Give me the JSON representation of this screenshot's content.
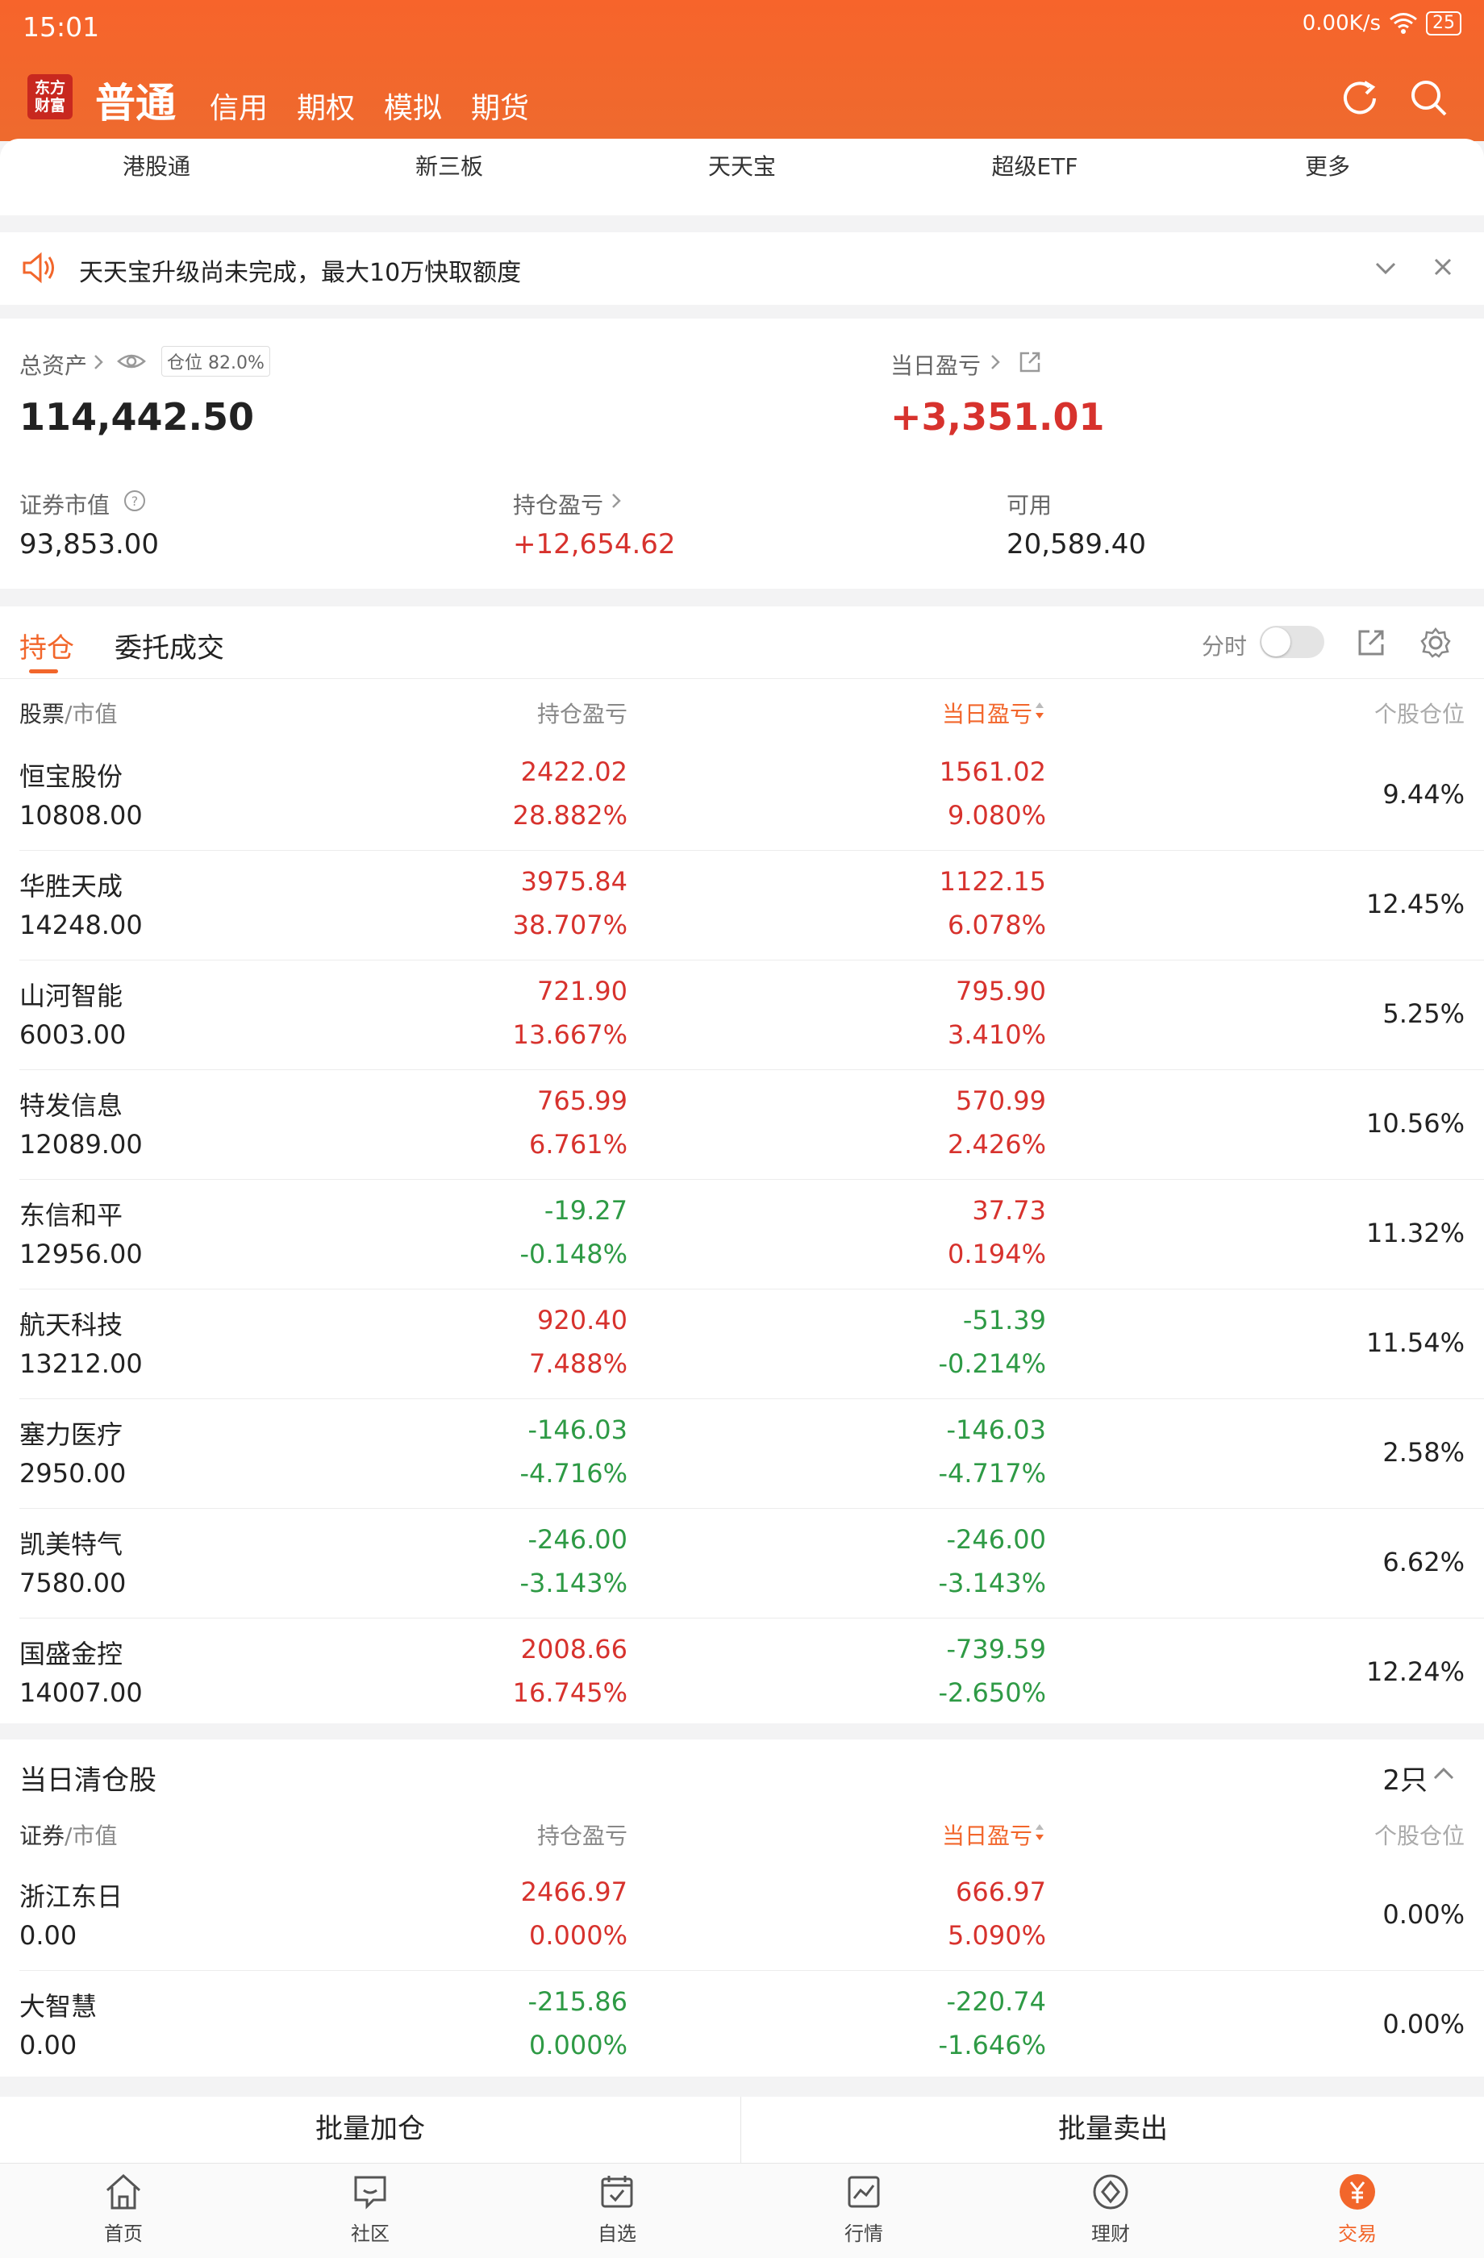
{
  "status_bar": {
    "time": "15:01",
    "speed": "0.00K/s",
    "battery": "25"
  },
  "header": {
    "logo_text": "东方财富",
    "active_tab": "普通",
    "tabs": [
      "信用",
      "期权",
      "模拟",
      "期货"
    ]
  },
  "subnav": [
    "港股通",
    "新三板",
    "天天宝",
    "超级ETF",
    "更多"
  ],
  "notice": {
    "text": "天天宝升级尚未完成，最大10万快取额度"
  },
  "asset": {
    "total_label": "总资产",
    "position_badge": "仓位 82.0%",
    "total_value": "114,442.50",
    "daily_pl_label": "当日盈亏",
    "daily_pl_value": "+3,351.01",
    "market_value_label": "证券市值",
    "market_value": "93,853.00",
    "holding_pl_label": "持仓盈亏",
    "holding_pl_value": "+12,654.62",
    "available_label": "可用",
    "available_value": "20,589.40"
  },
  "holdings_tabs": {
    "active": "持仓",
    "other": "委托成交",
    "fenshi": "分时"
  },
  "columns": {
    "stock_mv": "股票/市值",
    "stock": "股票",
    "mv": "/市值",
    "hold_pl": "持仓盈亏",
    "day_pl": "当日盈亏",
    "position": "个股仓位"
  },
  "holdings": [
    {
      "name": "恒宝股份",
      "mv": "10808.00",
      "hold_pl": "2422.02",
      "hold_pct": "28.882%",
      "day_pl": "1561.02",
      "day_pct": "9.080%",
      "position": "9.44%",
      "hold_up": true,
      "day_up": true
    },
    {
      "name": "华胜天成",
      "mv": "14248.00",
      "hold_pl": "3975.84",
      "hold_pct": "38.707%",
      "day_pl": "1122.15",
      "day_pct": "6.078%",
      "position": "12.45%",
      "hold_up": true,
      "day_up": true
    },
    {
      "name": "山河智能",
      "mv": "6003.00",
      "hold_pl": "721.90",
      "hold_pct": "13.667%",
      "day_pl": "795.90",
      "day_pct": "3.410%",
      "position": "5.25%",
      "hold_up": true,
      "day_up": true
    },
    {
      "name": "特发信息",
      "mv": "12089.00",
      "hold_pl": "765.99",
      "hold_pct": "6.761%",
      "day_pl": "570.99",
      "day_pct": "2.426%",
      "position": "10.56%",
      "hold_up": true,
      "day_up": true
    },
    {
      "name": "东信和平",
      "mv": "12956.00",
      "hold_pl": "-19.27",
      "hold_pct": "-0.148%",
      "day_pl": "37.73",
      "day_pct": "0.194%",
      "position": "11.32%",
      "hold_up": false,
      "day_up": true
    },
    {
      "name": "航天科技",
      "mv": "13212.00",
      "hold_pl": "920.40",
      "hold_pct": "7.488%",
      "day_pl": "-51.39",
      "day_pct": "-0.214%",
      "position": "11.54%",
      "hold_up": true,
      "day_up": false
    },
    {
      "name": "塞力医疗",
      "mv": "2950.00",
      "hold_pl": "-146.03",
      "hold_pct": "-4.716%",
      "day_pl": "-146.03",
      "day_pct": "-4.717%",
      "position": "2.58%",
      "hold_up": false,
      "day_up": false
    },
    {
      "name": "凯美特气",
      "mv": "7580.00",
      "hold_pl": "-246.00",
      "hold_pct": "-3.143%",
      "day_pl": "-246.00",
      "day_pct": "-3.143%",
      "position": "6.62%",
      "hold_up": false,
      "day_up": false
    },
    {
      "name": "国盛金控",
      "mv": "14007.00",
      "hold_pl": "2008.66",
      "hold_pct": "16.745%",
      "day_pl": "-739.59",
      "day_pct": "-2.650%",
      "position": "12.24%",
      "hold_up": true,
      "day_up": false
    }
  ],
  "cleared": {
    "title": "当日清仓股",
    "count": "2只",
    "col_sec": "证券",
    "col_mv": "/市值",
    "rows": [
      {
        "name": "浙江东日",
        "mv": "0.00",
        "hold_pl": "2466.97",
        "hold_pct": "0.000%",
        "day_pl": "666.97",
        "day_pct": "5.090%",
        "position": "0.00%",
        "hold_up": true,
        "day_up": true
      },
      {
        "name": "大智慧",
        "mv": "0.00",
        "hold_pl": "-215.86",
        "hold_pct": "0.000%",
        "day_pl": "-220.74",
        "day_pct": "-1.646%",
        "position": "0.00%",
        "hold_up": false,
        "day_up": false
      }
    ]
  },
  "batch": {
    "add": "批量加仓",
    "sell": "批量卖出"
  },
  "tabbar": [
    "首页",
    "社区",
    "自选",
    "行情",
    "理财",
    "交易"
  ],
  "tabbar_active": "交易",
  "colors": {
    "brand": "#f2662b",
    "up": "#d7322d",
    "down": "#2e9a45"
  }
}
